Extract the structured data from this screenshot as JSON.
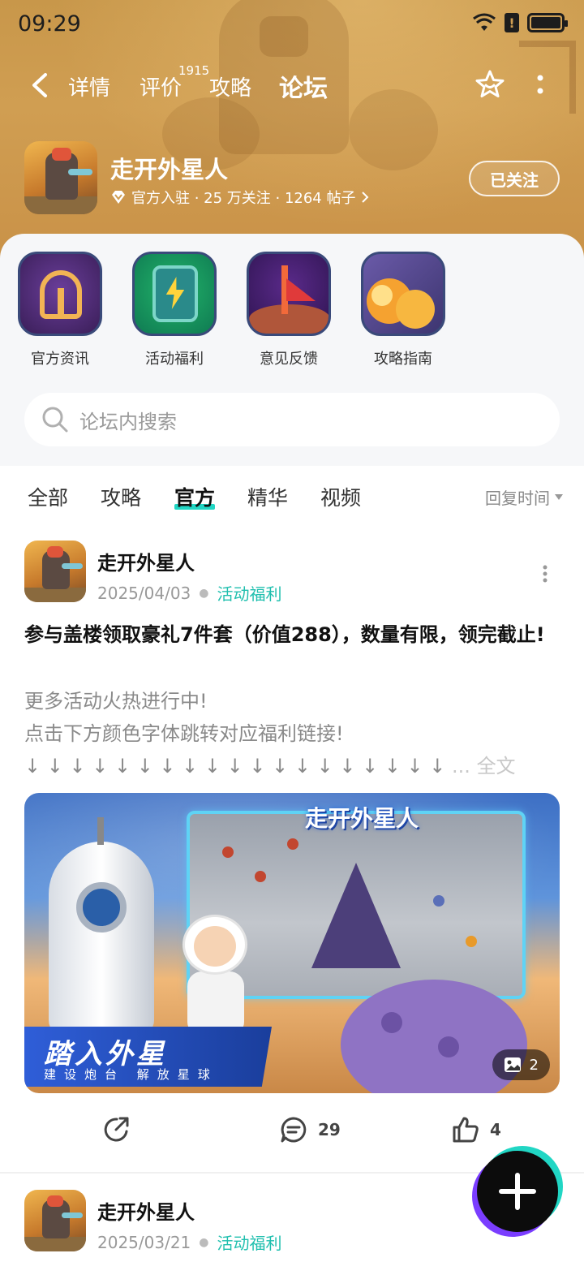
{
  "status_bar": {
    "time": "09:29"
  },
  "nav": {
    "tabs": [
      {
        "label": "详情"
      },
      {
        "label": "评价",
        "badge": "1915"
      },
      {
        "label": "攻略"
      },
      {
        "label": "论坛"
      }
    ],
    "active_tab": "论坛"
  },
  "game": {
    "name": "走开外星人",
    "meta": "官方入驻 · 25 万关注 · 1264 帖子",
    "follow_label": "已关注"
  },
  "categories": [
    {
      "label": "官方资讯",
      "icon": "helmet-icon"
    },
    {
      "label": "活动福利",
      "icon": "energy-box-icon"
    },
    {
      "label": "意见反馈",
      "icon": "flag-icon"
    },
    {
      "label": "攻略指南",
      "icon": "guide-icon"
    }
  ],
  "search": {
    "placeholder": "论坛内搜索"
  },
  "feed_tabs": {
    "items": [
      {
        "label": "全部"
      },
      {
        "label": "攻略"
      },
      {
        "label": "官方"
      },
      {
        "label": "精华"
      },
      {
        "label": "视频"
      }
    ],
    "active": "官方",
    "sort_label": "回复时间"
  },
  "posts": [
    {
      "author": "走开外星人",
      "date": "2025/04/03",
      "category": "活动福利",
      "title": "参与盖楼领取豪礼7件套（价值288），数量有限，领完截止!",
      "body_line1": "更多活动火热进行中!",
      "body_line2": "点击下方颜色字体跳转对应福利链接!",
      "body_line3": "↓ ↓ ↓ ↓ ↓ ↓ ↓ ↓ ↓ ↓ ↓ ↓ ↓ ↓ ↓ ↓ ↓ ↓ ↓",
      "more_label": "... 全文",
      "image": {
        "logo_text": "走开外星人",
        "banner_big": "踏入外星",
        "banner_small": "建设炮台 解放星球",
        "count": "2"
      },
      "comments": "29",
      "likes": "4"
    },
    {
      "author": "走开外星人",
      "date": "2025/03/21",
      "category": "活动福利"
    }
  ],
  "colors": {
    "accent": "#21d6c4",
    "category_link": "#1fbfae",
    "header_bg": "#d09e52"
  }
}
